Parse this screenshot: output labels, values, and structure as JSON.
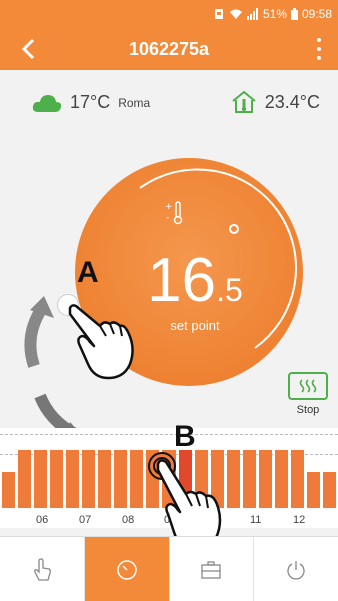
{
  "status_bar": {
    "battery": "51%",
    "time": "09:58"
  },
  "app_bar": {
    "title": "1062275a"
  },
  "weather": {
    "outdoor_temp": "17°C",
    "city": "Roma",
    "indoor_temp": "23.4°C"
  },
  "dial": {
    "setpoint_int": "16",
    "setpoint_dec": ".5",
    "setpoint_label": "set point"
  },
  "annotations": {
    "a": "A",
    "b": "B"
  },
  "stop": {
    "label": "Stop"
  },
  "schedule": {
    "hours": [
      "06",
      "07",
      "08",
      "09",
      "11",
      "12"
    ],
    "selected_slot_index": 11,
    "slot_levels": [
      0.45,
      0.73,
      0.73,
      0.73,
      0.73,
      0.73,
      0.73,
      0.73,
      0.73,
      0.73,
      0.73,
      0.73,
      0.73,
      0.73,
      0.73,
      0.73,
      0.73,
      0.73,
      0.73,
      0.45,
      0.45
    ]
  },
  "nav": {
    "items": [
      {
        "name": "manual",
        "icon": "hand-icon"
      },
      {
        "name": "schedule",
        "icon": "clock-icon",
        "active": true
      },
      {
        "name": "away",
        "icon": "briefcase-icon"
      },
      {
        "name": "power",
        "icon": "power-icon"
      }
    ]
  },
  "colors": {
    "accent": "#f28a3a",
    "active_slot": "#e2482b",
    "stop_green": "#4db04a"
  }
}
